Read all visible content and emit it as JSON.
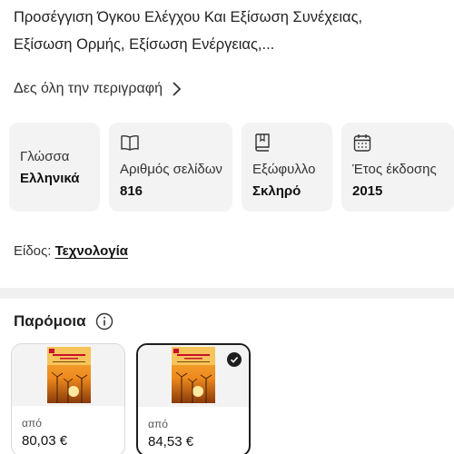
{
  "description": {
    "line1": "Προσέγγιση Όγκου Ελέγχου Και Εξίσωση Συνέχειας,",
    "line2": "Εξίσωση Ορμής, Εξίσωση Ενέργειας,..."
  },
  "see_all_label": "Δες όλη την περιγραφή",
  "specs": [
    {
      "label": "Γλώσσα",
      "value": "Ελληνικά"
    },
    {
      "label": "Αριθμός σελίδων",
      "value": "816",
      "icon": "book-open-icon"
    },
    {
      "label": "Εξώφυλλο",
      "value": "Σκληρό",
      "icon": "hardcover-book-icon"
    },
    {
      "label": "Έτος έκδοσης",
      "value": "2015",
      "icon": "calendar-icon"
    }
  ],
  "genre": {
    "label": "Είδος:",
    "value": "Τεχνολογία"
  },
  "similar": {
    "title": "Παρόμοια",
    "items": [
      {
        "from_label": "από",
        "price": "80,03 €",
        "selected": false
      },
      {
        "from_label": "από",
        "price": "84,53 €",
        "selected": true
      }
    ]
  },
  "colors": {
    "card_bg": "#f3f3f3",
    "cover_orange": "#f0a020",
    "cover_title": "#c8102e"
  }
}
